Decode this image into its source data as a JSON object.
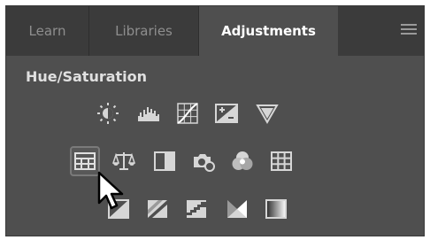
{
  "tabs": [
    {
      "label": "Learn",
      "active": false
    },
    {
      "label": "Libraries",
      "active": false
    },
    {
      "label": "Adjustments",
      "active": true
    }
  ],
  "panel_menu_icon": "hamburger-menu-icon",
  "section_title": "Hue/Saturation",
  "icons": {
    "row1": [
      "brightness-contrast-icon",
      "levels-icon",
      "curves-icon",
      "exposure-icon",
      "vibrance-icon"
    ],
    "row2": [
      "hue-saturation-icon",
      "color-balance-icon",
      "black-white-icon",
      "photo-filter-icon",
      "channel-mixer-icon",
      "color-lookup-icon"
    ],
    "row3": [
      "invert-icon",
      "posterize-icon",
      "threshold-icon",
      "selective-color-icon",
      "gradient-map-icon"
    ]
  },
  "hovered_icon": "hue-saturation-icon",
  "colors": {
    "panel_bg": "#4f4f4f",
    "tabbar_bg": "#3b3b3b",
    "icon_fill": "#d6d6d6",
    "active_tab_text": "#ffffff",
    "inactive_tab_text": "#8e8e8e"
  }
}
